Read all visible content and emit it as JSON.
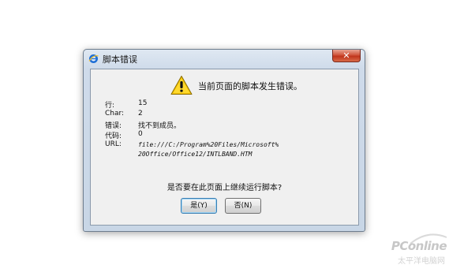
{
  "window": {
    "title": "脚本错误",
    "close_label": "✕",
    "icon": "ie-icon"
  },
  "message": "当前页面的脚本发生错误。",
  "message_icon": "warning-icon",
  "details": {
    "line_label": "行:",
    "line_value": "15",
    "char_label": "Char:",
    "char_value": "2",
    "error_label": "错误:",
    "error_value": "找不到成员。",
    "code_label": "代码:",
    "code_value": "0",
    "url_label": "URL:",
    "url_line1": "file:///C:/Program%20Files/Microsoft%",
    "url_line2": "20Office/Office12/INTLBAND.HTM"
  },
  "question": "是否要在此页面上继续运行脚本?",
  "buttons": {
    "yes_label": "是(Y)",
    "no_label": "否(N)"
  },
  "watermark": {
    "brand": "PConline",
    "sub": "太平洋电脑网"
  },
  "colors": {
    "close_button": "#c0351c",
    "window_frame": "#c8d6e6",
    "client_bg": "#f0f0f0",
    "warning_yellow": "#f5c400"
  }
}
